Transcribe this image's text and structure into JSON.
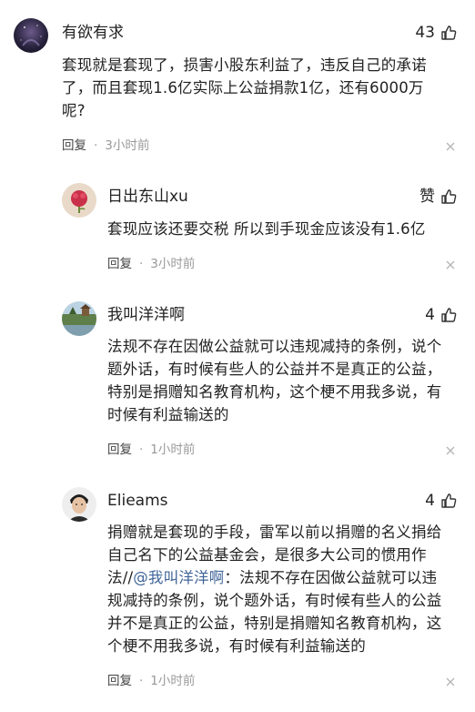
{
  "comments": [
    {
      "username": "有欲有求",
      "likes": "43",
      "lines": [
        "套现就是套现了，损害小股东利益了，违反自己的承诺",
        "了，而且套现1.6亿实际上公益捐款1亿，还有6000万",
        "呢?"
      ],
      "reply": "回复",
      "time": "3小时前"
    },
    {
      "username": "日出东山xu",
      "likes": "赞",
      "lines": [
        "套现应该还要交税 所以到手现金应该没有1.6亿"
      ],
      "reply": "回复",
      "time": "3小时前"
    },
    {
      "username": "我叫洋洋啊",
      "likes": "4",
      "lines": [
        "法规不存在因做公益就可以违规减持的条例，说个",
        "题外话，有时候有些人的公益并不是真正的公益，",
        "特别是捐赠知名教育机构，这个梗不用我多说，有",
        "时候有利益输送的"
      ],
      "reply": "回复",
      "time": "1小时前"
    },
    {
      "username": "Elieams",
      "likes": "4",
      "lines_before_mention": [
        "捐赠就是套现的手段，雷军以前以捐赠的名义捐给",
        "自己名下的公益基金会，是很多大公司的惯用作"
      ],
      "line_mention_prefix": "法//",
      "mention": "@我叫洋洋啊",
      "line_mention_suffix": "：法规不存在因做公益就可以违",
      "lines_after_mention": [
        "规减持的条例，说个题外话，有时候有些人的公益",
        "并不是真正的公益，特别是捐赠知名教育机构，这",
        "个梗不用我多说，有时候有利益输送的"
      ],
      "reply": "回复",
      "time": "1小时前"
    }
  ],
  "separator": "·",
  "colors": {
    "text": "#222222",
    "meta": "#999999",
    "mention": "#406599"
  },
  "icons": {
    "like": "thumbs-up-icon",
    "close": "close-icon"
  }
}
